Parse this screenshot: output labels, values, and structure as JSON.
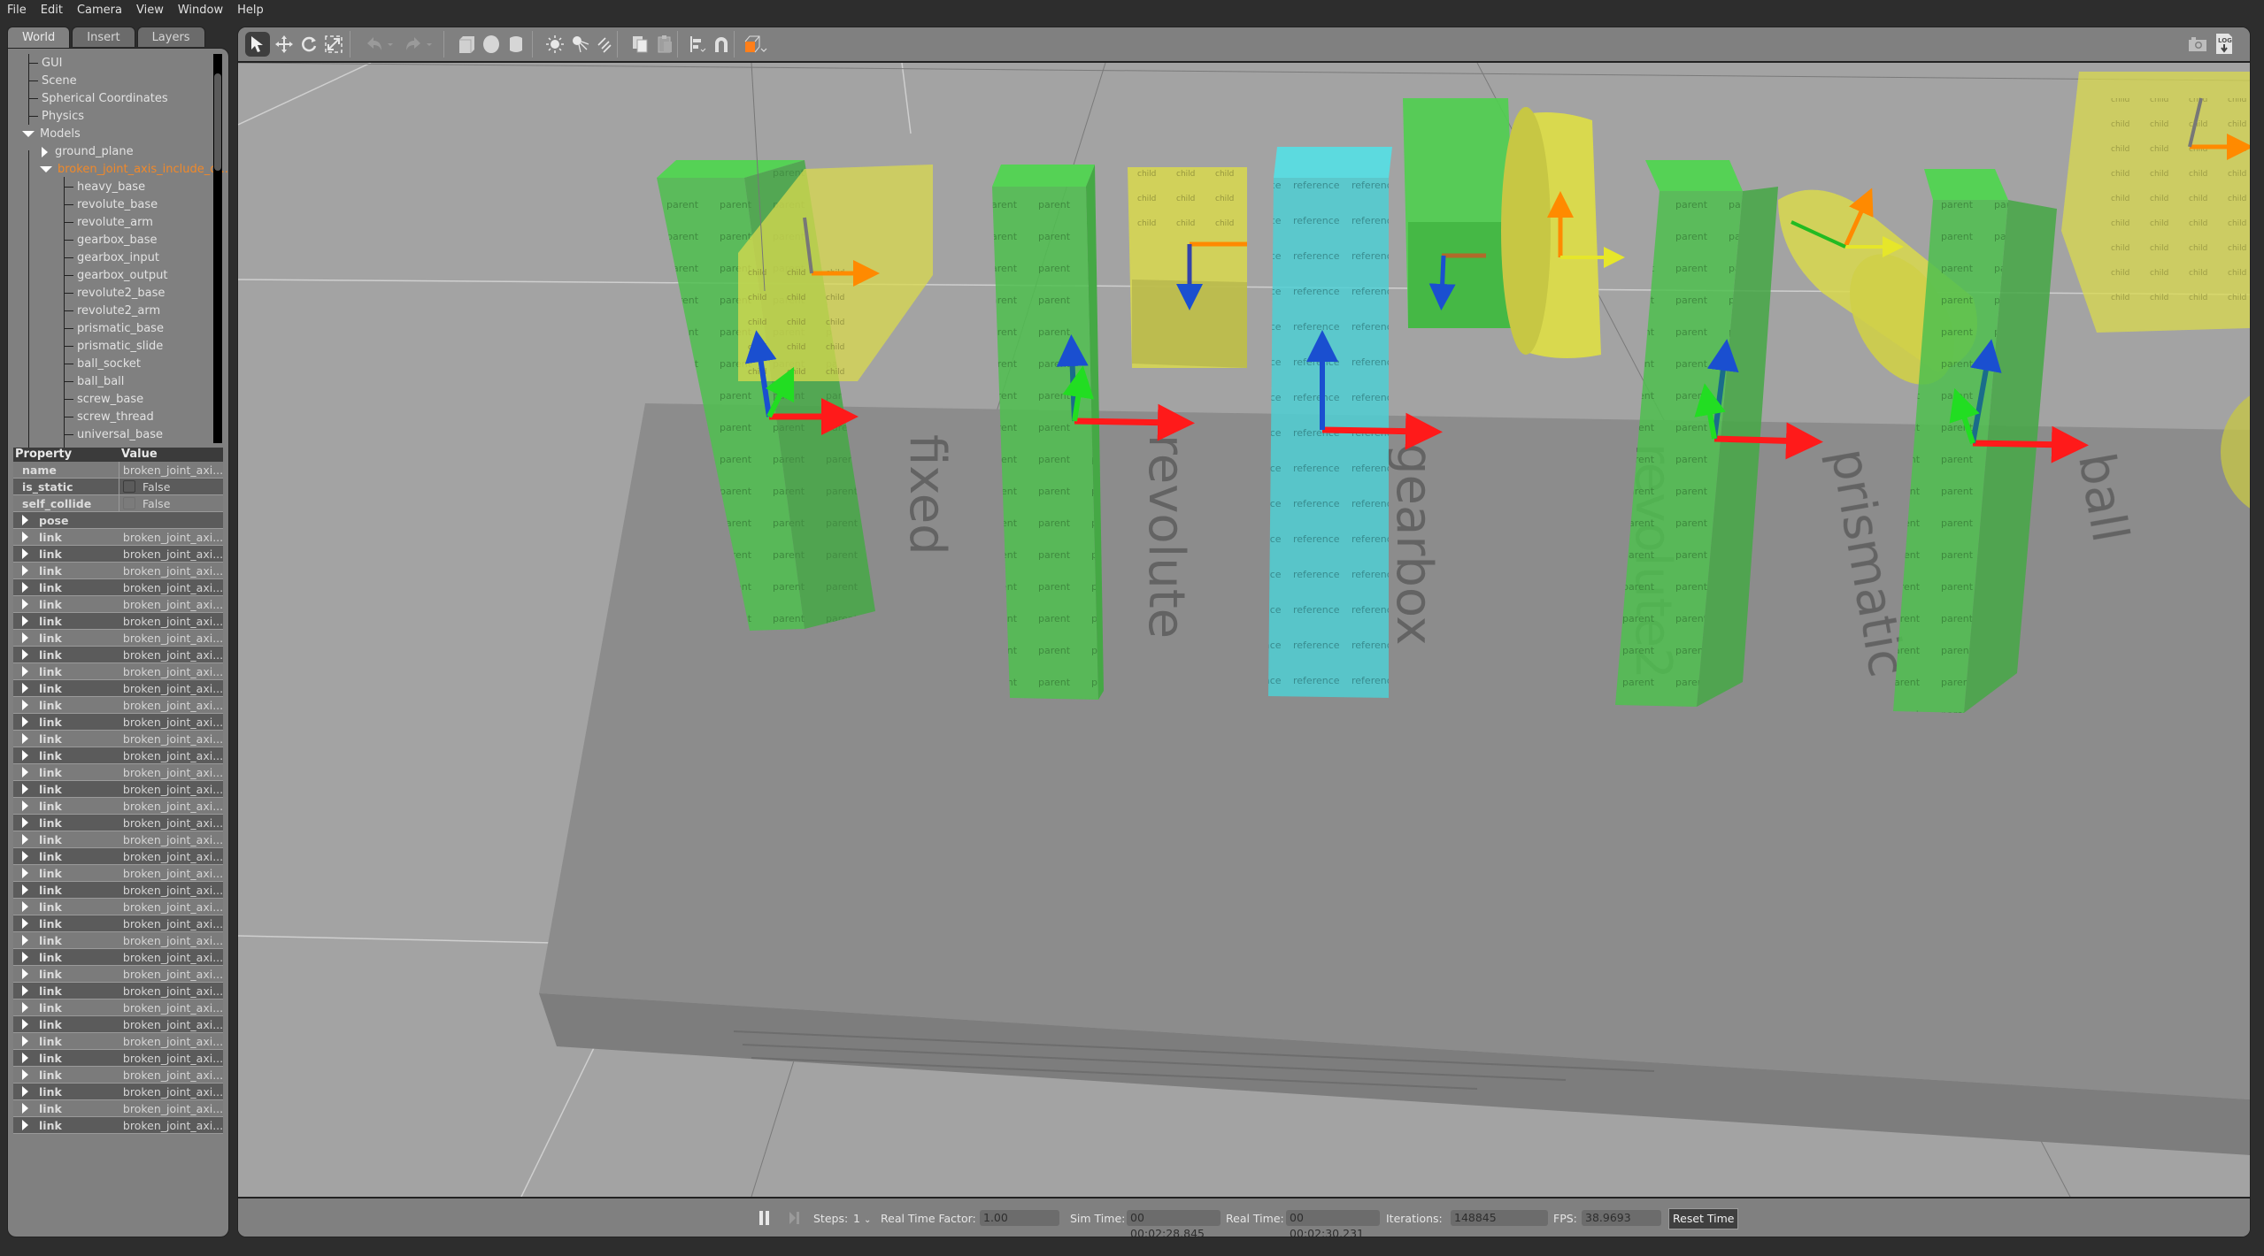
{
  "menu": [
    "File",
    "Edit",
    "Camera",
    "View",
    "Window",
    "Help"
  ],
  "left_tabs": [
    {
      "label": "World",
      "active": true
    },
    {
      "label": "Insert",
      "active": false
    },
    {
      "label": "Layers",
      "active": false
    }
  ],
  "world_tree": {
    "top_items": [
      "GUI",
      "Scene",
      "Spherical Coordinates",
      "Physics"
    ],
    "models_label": "Models",
    "ground_plane": "ground_plane",
    "selected_model": "broken_joint_axis_include_d...",
    "links": [
      "heavy_base",
      "revolute_base",
      "revolute_arm",
      "gearbox_base",
      "gearbox_input",
      "gearbox_output",
      "revolute2_base",
      "revolute2_arm",
      "prismatic_base",
      "prismatic_slide",
      "ball_socket",
      "ball_ball",
      "screw_base",
      "screw_thread",
      "universal_base"
    ]
  },
  "properties": {
    "header": {
      "property": "Property",
      "value": "Value"
    },
    "name": {
      "label": "name",
      "value": "broken_joint_axi..."
    },
    "is_static": {
      "label": "is_static",
      "value": "False",
      "checked": false
    },
    "self_collide": {
      "label": "self_collide",
      "value": "False",
      "checked": false
    },
    "pose_label": "pose",
    "link_label": "link",
    "link_value": "broken_joint_axi...",
    "link_count": 36
  },
  "toolbar": {
    "tools": [
      {
        "name": "select-mode",
        "icon": "arrow-pointer-icon",
        "active": true
      },
      {
        "name": "translate-mode",
        "icon": "move-arrows-icon"
      },
      {
        "name": "rotate-mode",
        "icon": "rotate-icon"
      },
      {
        "name": "scale-mode",
        "icon": "scale-icon"
      },
      {
        "name": "undo",
        "icon": "undo-icon"
      },
      {
        "name": "undo-history",
        "icon": "chevron-down-icon"
      },
      {
        "name": "redo",
        "icon": "redo-icon"
      },
      {
        "name": "redo-history",
        "icon": "chevron-down-icon"
      },
      {
        "name": "box-shape",
        "icon": "box-icon"
      },
      {
        "name": "sphere-shape",
        "icon": "sphere-icon"
      },
      {
        "name": "cylinder-shape",
        "icon": "cylinder-icon"
      },
      {
        "name": "point-light",
        "icon": "point-light-icon"
      },
      {
        "name": "spot-light",
        "icon": "spot-light-icon"
      },
      {
        "name": "directional-light",
        "icon": "directional-light-icon"
      },
      {
        "name": "copy",
        "icon": "copy-icon"
      },
      {
        "name": "paste",
        "icon": "paste-icon"
      },
      {
        "name": "align",
        "icon": "align-icon"
      },
      {
        "name": "snap",
        "icon": "magnet-icon"
      },
      {
        "name": "view-angle",
        "icon": "view-cube-icon"
      }
    ],
    "right_tools": [
      {
        "name": "screenshot",
        "icon": "camera-icon"
      },
      {
        "name": "log",
        "icon": "log-download-icon",
        "label": "LOG"
      }
    ]
  },
  "scene": {
    "ground_labels": [
      "fixed",
      "revolute",
      "gearbox",
      "revolute2",
      "prismatic",
      "ball"
    ],
    "texture_words": {
      "parent": "parent",
      "child": "child",
      "reference": "reference"
    },
    "colors": {
      "background": "#a3a3a3",
      "platform": "#8a8a8a",
      "parent_green": "#4fc24f",
      "child_yellow": "#d8d84a",
      "reference_cyan": "#4ecfd4",
      "axis_x": "#ff1a1a",
      "axis_y": "#22dd22",
      "axis_z": "#1a4fd0",
      "joint_orange": "#ff8a00"
    }
  },
  "status": {
    "pause_icon": "pause-icon",
    "step_icon": "step-icon",
    "steps_label": "Steps:",
    "steps_value": "1",
    "rtf_label": "Real Time Factor:",
    "rtf_value": "1.00",
    "sim_time_label": "Sim Time:",
    "sim_time_value": "00 00:02:28.845",
    "real_time_label": "Real Time:",
    "real_time_value": "00 00:02:30.231",
    "iterations_label": "Iterations:",
    "iterations_value": "148845",
    "fps_label": "FPS:",
    "fps_value": "38.9693",
    "reset_label": "Reset Time"
  }
}
